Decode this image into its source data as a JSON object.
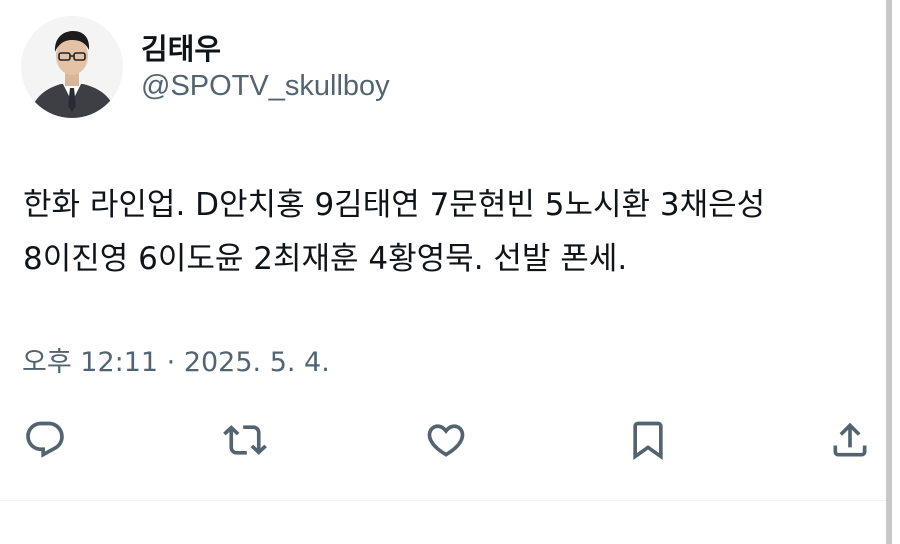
{
  "author": {
    "display_name": "김태우",
    "handle": "@SPOTV_skullboy"
  },
  "tweet": {
    "line1": "한화 라인업. D안치홍 9김태연 7문현빈 5노시환 3채은성",
    "line2": "8이진영 6이도윤 2최재훈 4황영묵. 선발 폰세.",
    "timestamp": "오후 12:11 · 2025. 5. 4."
  },
  "actions": [
    {
      "icon": "reply-icon"
    },
    {
      "icon": "retweet-icon"
    },
    {
      "icon": "like-icon"
    },
    {
      "icon": "bookmark-icon"
    },
    {
      "icon": "share-icon"
    }
  ],
  "colors": {
    "text": "#0f1419",
    "secondary": "#536471",
    "divider": "#eff3f4"
  }
}
